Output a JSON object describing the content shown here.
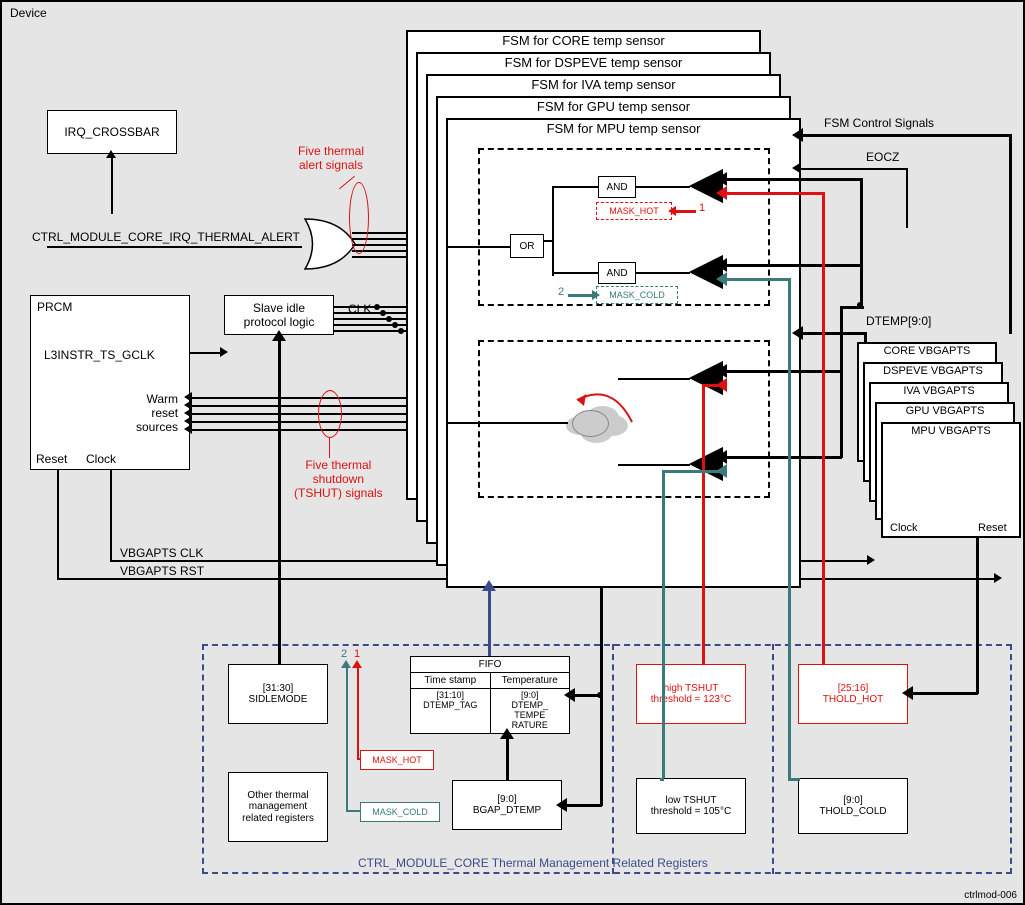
{
  "device_label": "Device",
  "figure_id": "ctrlmod-006",
  "irq_crossbar": "IRQ_CROSSBAR",
  "thermal_alert_sig": "CTRL_MODULE_CORE_IRQ_THERMAL_ALERT",
  "five_alert": "Five thermal\nalert signals",
  "five_tshut": "Five thermal\nshutdown\n(TSHUT) signals",
  "prcm": {
    "title": "PRCM",
    "l3clk": "L3INSTR_TS_GCLK",
    "warm_reset": "Warm\nreset\nsources",
    "reset": "Reset",
    "clock": "Clock"
  },
  "slave_idle": "Slave idle\nprotocol logic",
  "clk_label": "CLK",
  "vbgapts_clk": "VBGAPTS CLK",
  "vbgapts_rst": "VBGAPTS RST",
  "fsm_stack": [
    "FSM for CORE temp sensor",
    "FSM for DSPEVE temp sensor",
    "FSM for IVA temp sensor",
    "FSM for GPU temp sensor",
    "FSM for MPU temp sensor"
  ],
  "logic": {
    "and": "AND",
    "or": "OR",
    "mask_hot": "MASK_HOT",
    "mask_cold": "MASK_COLD",
    "lt": "<",
    "gt": ">"
  },
  "one": "1",
  "two": "2",
  "fsm_ctrl_sig": "FSM Control Signals",
  "eocz": "EOCZ",
  "dtemp": "DTEMP[9:0]",
  "vbgapts_stack": [
    "CORE VBGAPTS",
    "DSPEVE VBGAPTS",
    "IVA VBGAPTS",
    "GPU VBGAPTS",
    "MPU VBGAPTS"
  ],
  "vbgapts_ports": {
    "clock": "Clock",
    "reset": "Reset"
  },
  "regs_caption": "CTRL_MODULE_CORE Thermal Management Related Registers",
  "sidlemode": {
    "bits": "[31:30]",
    "name": "SIDLEMODE"
  },
  "other_regs": "Other thermal\nmanagement\nrelated registers",
  "fifo": {
    "title": "FIFO",
    "ts": "Time stamp",
    "temp": "Temperature",
    "ts_bits": "[31:10]\nDTEMP_TAG",
    "temp_bits": "[9:0]\nDTEMP_\nTEMPE\nRATURE"
  },
  "bgap_dtemp": {
    "bits": "[9:0]",
    "name": "BGAP_DTEMP"
  },
  "mask_hot_reg": "MASK_HOT",
  "mask_cold_reg": "MASK_COLD",
  "high_tshut": "high TSHUT\nthreshold = 123°C",
  "low_tshut": "low TSHUT\nthreshold = 105°C",
  "thold_hot": {
    "bits": "[25:16]",
    "name": "THOLD_HOT"
  },
  "thold_cold": {
    "bits": "[9:0]",
    "name": "THOLD_COLD"
  }
}
